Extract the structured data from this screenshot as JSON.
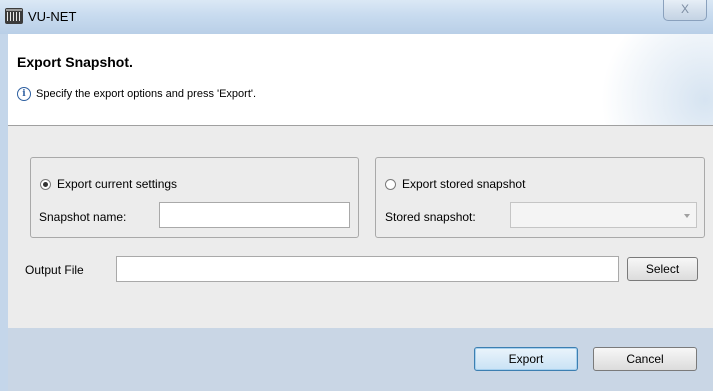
{
  "window": {
    "title": "VU-NET",
    "close_glyph": "X",
    "app_icon": "vu-net-app-icon"
  },
  "header": {
    "title": "Export Snapshot.",
    "info_icon_glyph": "i",
    "description": "Specify the export options and press 'Export'."
  },
  "current_settings": {
    "radio_label": "Export current settings",
    "selected": true,
    "name_label": "Snapshot name:",
    "name_value": ""
  },
  "stored_snapshot": {
    "radio_label": "Export stored snapshot",
    "selected": false,
    "select_label": "Stored snapshot:",
    "select_value": ""
  },
  "output": {
    "label": "Output File",
    "value": "",
    "select_button": "Select"
  },
  "footer": {
    "export_button": "Export",
    "cancel_button": "Cancel"
  }
}
